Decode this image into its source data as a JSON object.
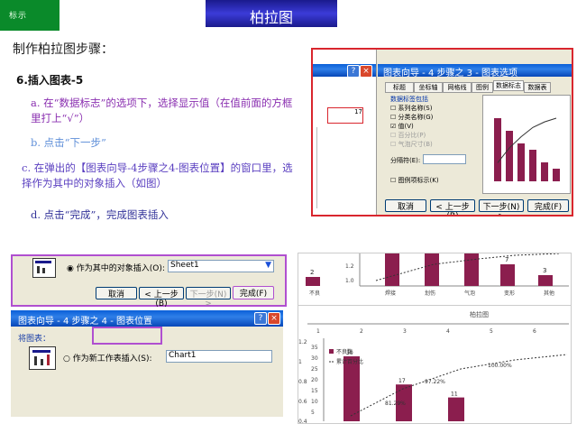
{
  "header": {
    "logo": "标示",
    "title": "柏拉图"
  },
  "heading": "制作柏拉图步骤：",
  "step": {
    "number": "6.",
    "label": "插入图表-5"
  },
  "instructions": {
    "a": "a. 在“数据标志”的选项下，选择显示值（在值前面的方框里打上“√”）",
    "b": "b. 点击“下一步”",
    "c": "c. 在弹出的【图表向导-4步骤之4-图表位置】的窗口里，选择作为其中的对象插入（如图）",
    "d": "d. 点击“完成”，完成图表插入"
  },
  "shot1": {
    "title": "图表向导 - 4 步骤之 3 - 图表选项",
    "tabs": [
      "标题",
      "坐标轴",
      "网格线",
      "图例",
      "数据标志",
      "数据表"
    ],
    "group_label": "数据标签包括",
    "options": [
      {
        "label": "系列名称(S)",
        "checked": false
      },
      {
        "label": "分类名称(G)",
        "checked": false
      },
      {
        "label": "值(V)",
        "checked": true
      },
      {
        "label": "百分比(P)",
        "checked": false
      },
      {
        "label": "气泡尺寸(B)",
        "checked": false
      }
    ],
    "separator_label": "分隔符(E):",
    "legend_key_label": "图例项标示(K)",
    "side_axis": "17",
    "preview_values": [
      10,
      8,
      6,
      5,
      3,
      2
    ],
    "buttons": [
      "取消",
      "< 上一步(B)",
      "下一步(N) >",
      "完成(F)"
    ]
  },
  "shot2": {
    "option_label": "作为其中的对象插入(O):",
    "sheet_value": "Sheet1",
    "buttons": {
      "cancel": "取消",
      "back": "< 上一步(B)",
      "next": "下一步(N) >",
      "finish": "完成(F)"
    }
  },
  "shot3": {
    "title": "图表向导 - 4 步骤之 4 - 图表位置",
    "section_label": "将图表：",
    "option_label": "作为新工作表插入(S):",
    "sheet_value": "Chart1"
  },
  "chart_top": {
    "axis_ticks": [
      "1.2",
      "1.0"
    ],
    "bar_labels": [
      "2",
      "7",
      "3"
    ],
    "categories": [
      "不良",
      "焊接",
      "划伤",
      "气泡",
      "变形",
      "其他"
    ]
  },
  "chart_bottom": {
    "xaxis_ticks": [
      "1",
      "2",
      "3",
      "4",
      "5",
      "6"
    ],
    "yaxis_ticks": [
      "35",
      "30",
      "25",
      "20",
      "15",
      "10",
      "5"
    ],
    "y2_ticks": [
      "1.2",
      "1",
      "0.8",
      "0.6",
      "0.4"
    ],
    "axis_title": "柏拉图",
    "bar_labels": [
      "30",
      "17",
      "11"
    ],
    "line_labels": [
      "100.00%",
      "97.22%",
      "81.29%"
    ],
    "legend": [
      "不良数",
      "累计百分比"
    ]
  },
  "colors": {
    "bar": "#8b1e4e",
    "frame_red": "#d9262e",
    "frame_purple": "#b04fd0",
    "title_bar": "#2a2ab0"
  }
}
